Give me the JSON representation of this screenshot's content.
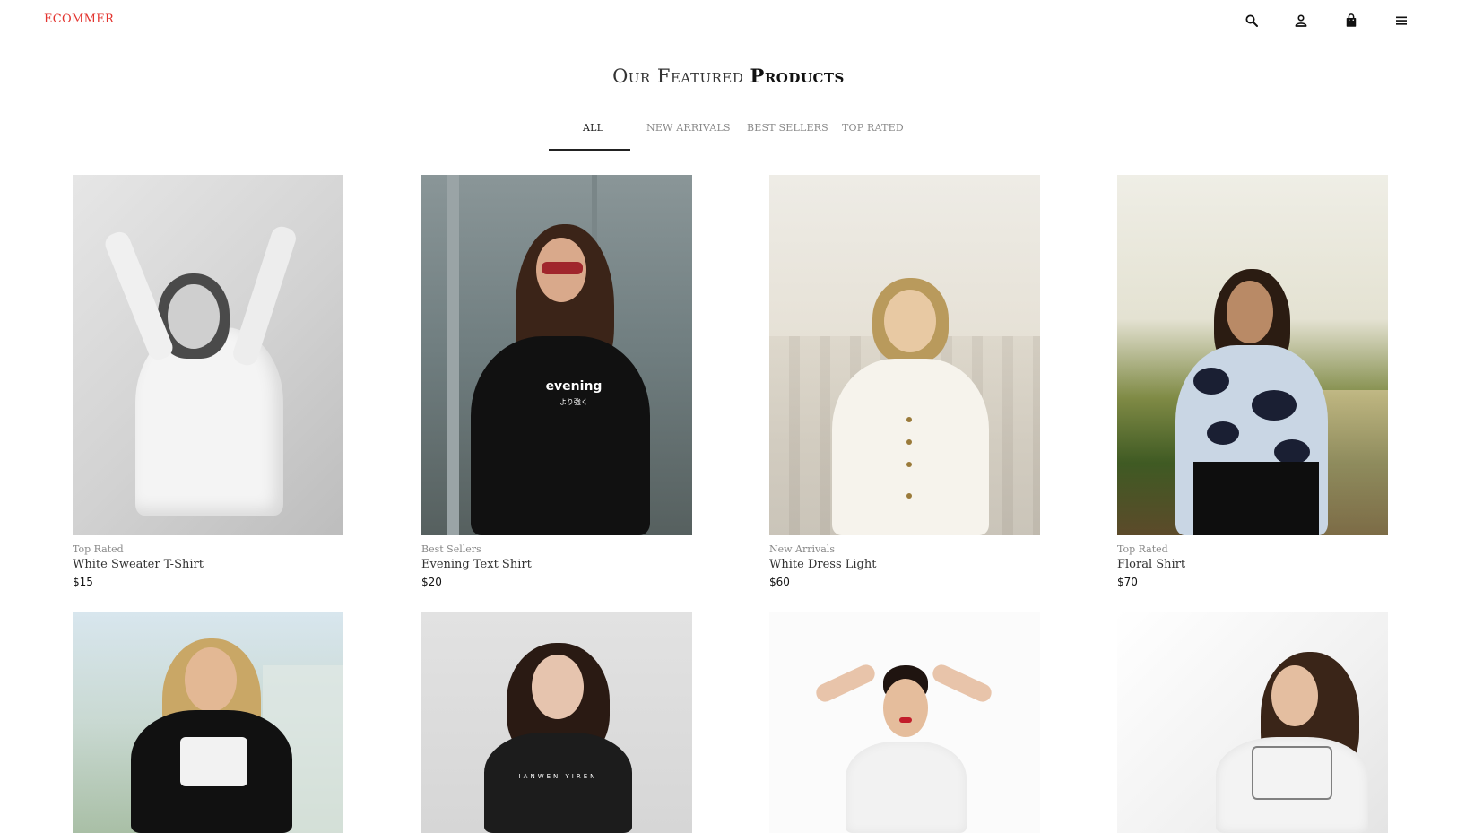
{
  "header": {
    "logo": "ECOMMER",
    "icons": [
      "search-icon",
      "user-icon",
      "bag-icon",
      "menu-icon"
    ]
  },
  "section": {
    "title_light": "Our Featured",
    "title_bold": "Products"
  },
  "tabs": [
    {
      "label": "ALL",
      "active": true
    },
    {
      "label": "NEW ARRIVALS",
      "active": false
    },
    {
      "label": "BEST SELLERS",
      "active": false
    },
    {
      "label": "TOP RATED",
      "active": false
    }
  ],
  "products": [
    {
      "category": "Top Rated",
      "name": "White Sweater T-Shirt",
      "price": "$15"
    },
    {
      "category": "Best Sellers",
      "name": "Evening Text Shirt",
      "price": "$20",
      "shirt_text": "evening",
      "shirt_subtext": "より強く"
    },
    {
      "category": "New Arrivals",
      "name": "White Dress Light",
      "price": "$60"
    },
    {
      "category": "Top Rated",
      "name": "Floral Shirt",
      "price": "$70"
    },
    {
      "category": "",
      "name": "",
      "price": ""
    },
    {
      "category": "",
      "name": "",
      "price": "",
      "shirt_text": "IANWEN YIREN"
    },
    {
      "category": "",
      "name": "",
      "price": ""
    },
    {
      "category": "",
      "name": "",
      "price": ""
    }
  ],
  "colors": {
    "logo": "#e3342f",
    "tab_active": "#222222",
    "tab_inactive": "#8a8a8a"
  }
}
